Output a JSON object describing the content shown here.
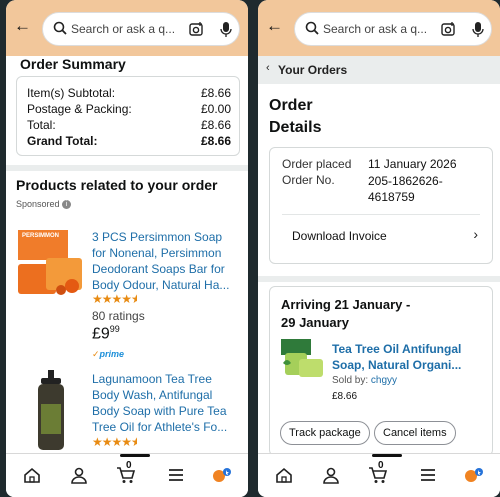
{
  "common": {
    "search_placeholder": "Search or ask a q...",
    "cart_count": "0"
  },
  "left": {
    "order_summary": {
      "title": "Order Summary",
      "rows": [
        {
          "label": "Item(s) Subtotal:",
          "value": "£8.66"
        },
        {
          "label": "Postage & Packing:",
          "value": "£0.00"
        },
        {
          "label": "Total:",
          "value": "£8.66"
        },
        {
          "label": "Grand Total:",
          "value": "£8.66"
        }
      ]
    },
    "related": {
      "title": "Products related to your order",
      "sponsored": "Sponsored",
      "products": [
        {
          "title_lines": [
            "3 PCS Persimmon Soap",
            "for Nonenal, Persimmon",
            "Deodorant Soaps Bar for",
            "Body Odour, Natural Ha..."
          ],
          "brand_label": "PERSIMMON",
          "rating": 4.5,
          "ratings_count": "80 ratings",
          "price_main": "£9",
          "price_frac": "99",
          "prime": "prime"
        },
        {
          "title_lines": [
            "Lagunamoon Tea Tree",
            "Body Wash, Antifungal",
            "Body Soap with Pure Tea",
            "Tree Oil for Athlete's Fo..."
          ],
          "rating": 4.5
        }
      ]
    }
  },
  "right": {
    "breadcrumb": "Your Orders",
    "heading_lines": [
      "Order",
      "Details"
    ],
    "order_placed_label": "Order placed",
    "order_placed_value": "11 January 2026",
    "order_no_label": "Order No.",
    "order_no_lines": [
      "205-1862626-",
      "4618759"
    ],
    "download_invoice": "Download Invoice",
    "arriving_lines": [
      "Arriving 21 January -",
      "29 January"
    ],
    "item": {
      "title_lines": [
        "Tea Tree Oil Antifungal",
        "Soap, Natural Organi..."
      ],
      "sold_by_label": "Sold by:",
      "sold_by": "chgyy",
      "price": "£8.66"
    },
    "buttons": [
      "Track package",
      "Cancel items"
    ]
  },
  "colors": {
    "topbar": "#f2c79b",
    "link": "#1e6ea8",
    "star": "#e88b13",
    "prime": "#1d8fd9"
  }
}
